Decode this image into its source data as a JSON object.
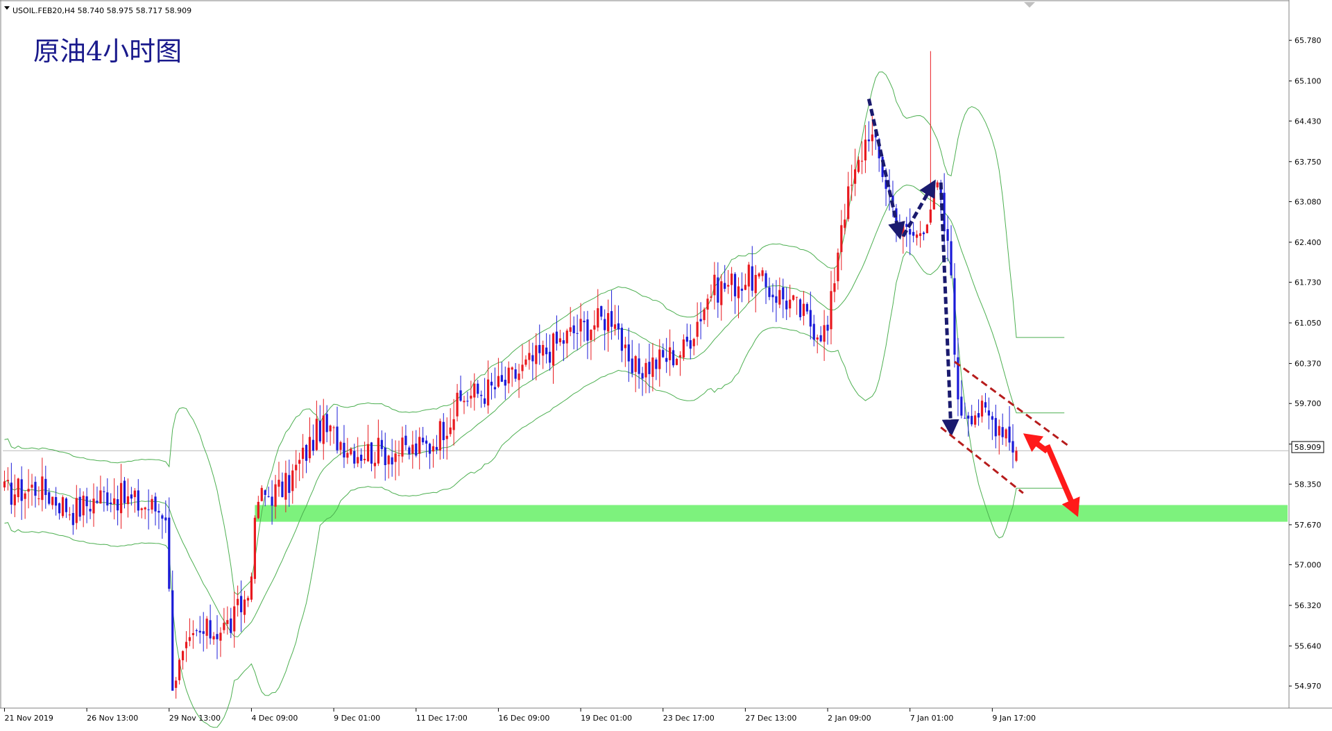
{
  "header": {
    "symbol_line": "USOIL.FEB20,H4  58.740 58.975 58.717 58.909",
    "menu_icon": "triangle-down-icon"
  },
  "overlay": {
    "title": "原油4小时图"
  },
  "price_label": "58.909",
  "colors": {
    "background": "#ffffff",
    "frame": "#808080",
    "bull_candle": "#e8191f",
    "bear_candle": "#1b1bd8",
    "bollinger": "#4caf50",
    "support_zone": "#7df27d",
    "dark_arrow": "#1a1a6e",
    "red_arrow": "#ff1a1a",
    "channel": "#b71c1c",
    "title": "#1a1a8c"
  },
  "chart_data": {
    "type": "candlestick",
    "symbol": "USOIL.FEB20",
    "timeframe": "H4",
    "ohlc_last": {
      "open": 58.74,
      "high": 58.975,
      "low": 58.717,
      "close": 58.909
    },
    "current_price": 58.909,
    "ylim": [
      54.6,
      66.2
    ],
    "y_ticks": [
      65.78,
      65.1,
      64.43,
      63.75,
      63.08,
      62.4,
      61.73,
      61.05,
      60.37,
      59.7,
      59.02,
      58.35,
      57.67,
      57.0,
      56.32,
      55.64,
      54.97
    ],
    "x_tick_labels": [
      "21 Nov 2019",
      "26 Nov 13:00",
      "29 Nov 13:00",
      "4 Dec 09:00",
      "9 Dec 01:00",
      "11 Dec 17:00",
      "16 Dec 09:00",
      "19 Dec 01:00",
      "23 Dec 17:00",
      "27 Dec 13:00",
      "2 Jan 09:00",
      "7 Jan 01:00",
      "9 Jan 17:00"
    ],
    "x_tick_index": [
      0,
      24,
      48,
      72,
      96,
      120,
      144,
      168,
      192,
      216,
      240,
      264,
      288
    ],
    "total_bars": 375,
    "support_zone": [
      57.72,
      58.0
    ],
    "anchors": [
      [
        0,
        58.2
      ],
      [
        10,
        58.3
      ],
      [
        20,
        57.9
      ],
      [
        30,
        58.2
      ],
      [
        40,
        58.0
      ],
      [
        47,
        57.9
      ],
      [
        49,
        55.1
      ],
      [
        56,
        55.8
      ],
      [
        66,
        56.0
      ],
      [
        71,
        56.5
      ],
      [
        74,
        58.1
      ],
      [
        82,
        58.3
      ],
      [
        92,
        59.3
      ],
      [
        103,
        58.9
      ],
      [
        118,
        58.9
      ],
      [
        124,
        59.0
      ],
      [
        134,
        59.8
      ],
      [
        145,
        60.0
      ],
      [
        156,
        60.5
      ],
      [
        166,
        60.9
      ],
      [
        178,
        61.2
      ],
      [
        182,
        60.2
      ],
      [
        190,
        60.4
      ],
      [
        198,
        60.6
      ],
      [
        206,
        61.6
      ],
      [
        218,
        61.8
      ],
      [
        229,
        61.4
      ],
      [
        236,
        61.0
      ],
      [
        240,
        60.9
      ],
      [
        244,
        62.8
      ],
      [
        248,
        63.5
      ],
      [
        252,
        64.3
      ],
      [
        256,
        63.6
      ],
      [
        261,
        62.6
      ],
      [
        266,
        62.5
      ],
      [
        272,
        63.3
      ],
      [
        273,
        63.0
      ],
      [
        276,
        61.9
      ],
      [
        278,
        59.6
      ],
      [
        283,
        59.6
      ],
      [
        292,
        59.3
      ],
      [
        295,
        58.9
      ]
    ],
    "annotations": [
      {
        "kind": "dashed-arrow",
        "color": "dark",
        "from": [
          252,
          64.8
        ],
        "to": [
          261,
          62.5
        ]
      },
      {
        "kind": "dashed-arrow",
        "color": "dark",
        "from": [
          262,
          62.5
        ],
        "to": [
          271,
          63.4
        ]
      },
      {
        "kind": "dashed-arrow",
        "color": "dark",
        "from": [
          273,
          63.4
        ],
        "to": [
          276,
          59.2
        ]
      },
      {
        "kind": "channel-line",
        "from": [
          277,
          60.4
        ],
        "to": [
          310,
          59.0
        ]
      },
      {
        "kind": "channel-line",
        "from": [
          273,
          59.3
        ],
        "to": [
          297,
          58.2
        ]
      },
      {
        "kind": "solid-arrow",
        "color": "red",
        "from": [
          304,
          58.9
        ],
        "to": [
          297,
          59.2
        ]
      },
      {
        "kind": "solid-arrow",
        "color": "red",
        "from": [
          304,
          59.0
        ],
        "to": [
          313,
          57.8
        ]
      }
    ]
  }
}
